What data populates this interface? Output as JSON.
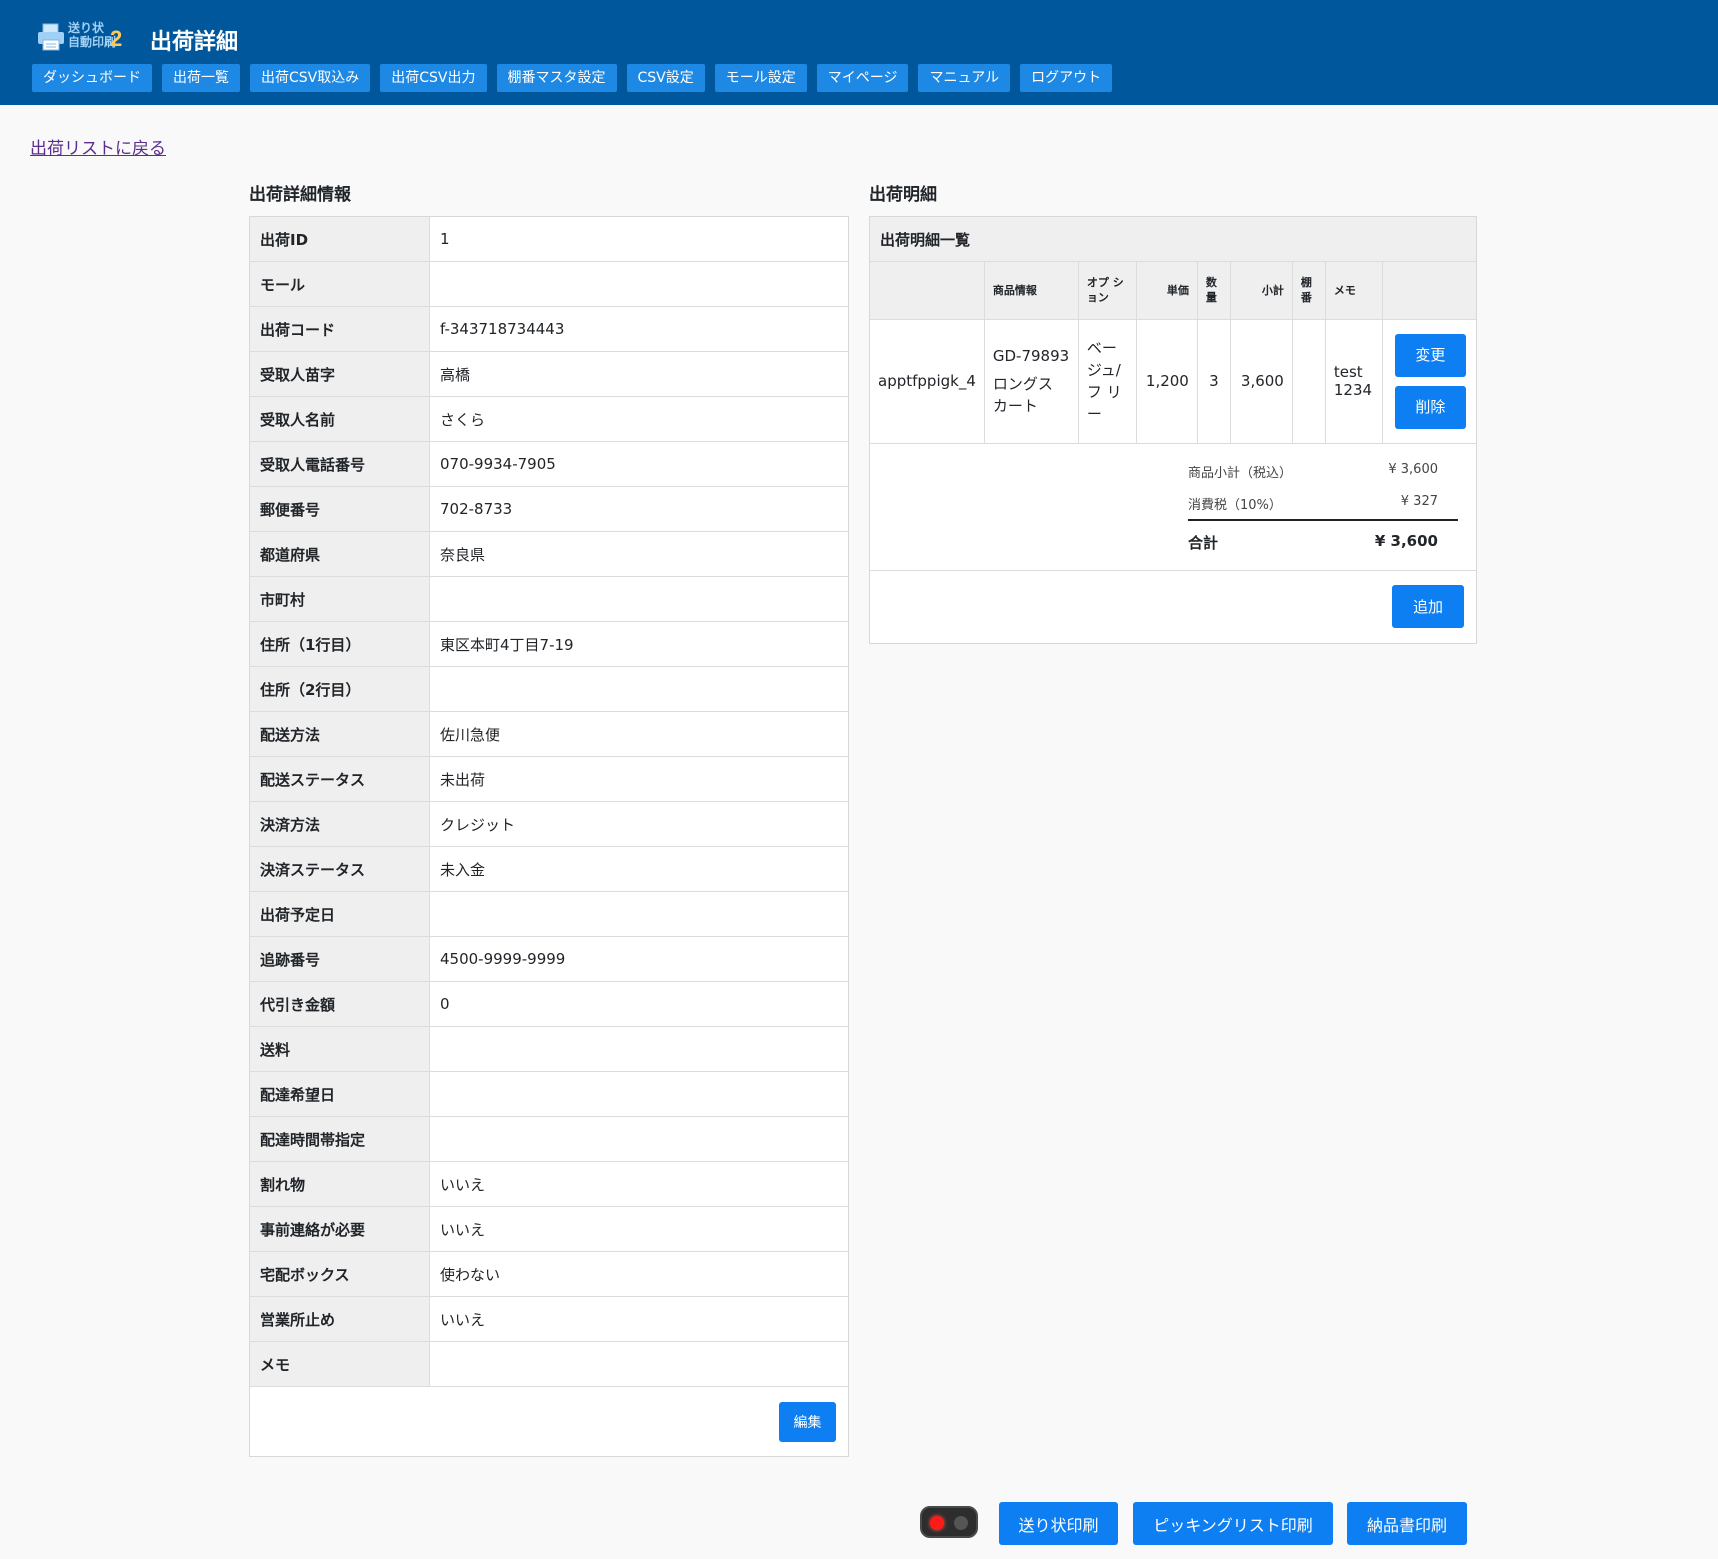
{
  "header": {
    "logo_text_line1": "送り状",
    "logo_text_line2": "自動印刷",
    "logo_number": "2",
    "title": "出荷詳細",
    "nav": [
      "ダッシュボード",
      "出荷一覧",
      "出荷CSV取込み",
      "出荷CSV出力",
      "棚番マスタ設定",
      "CSV設定",
      "モール設定",
      "マイページ",
      "マニュアル",
      "ログアウト"
    ]
  },
  "back_link": "出荷リストに戻る",
  "detail": {
    "title": "出荷詳細情報",
    "rows": [
      {
        "label": "出荷ID",
        "value": "1"
      },
      {
        "label": "モール",
        "value": ""
      },
      {
        "label": "出荷コード",
        "value": "f-343718734443"
      },
      {
        "label": "受取人苗字",
        "value": "高橋"
      },
      {
        "label": "受取人名前",
        "value": "さくら"
      },
      {
        "label": "受取人電話番号",
        "value": "070-9934-7905"
      },
      {
        "label": "郵便番号",
        "value": "702-8733"
      },
      {
        "label": "都道府県",
        "value": "奈良県"
      },
      {
        "label": "市町村",
        "value": ""
      },
      {
        "label": "住所（1行目）",
        "value": "東区本町4丁目7-19"
      },
      {
        "label": "住所（2行目）",
        "value": ""
      },
      {
        "label": "配送方法",
        "value": "佐川急便"
      },
      {
        "label": "配送ステータス",
        "value": "未出荷"
      },
      {
        "label": "決済方法",
        "value": "クレジット"
      },
      {
        "label": "決済ステータス",
        "value": "未入金"
      },
      {
        "label": "出荷予定日",
        "value": ""
      },
      {
        "label": "追跡番号",
        "value": "4500-9999-9999"
      },
      {
        "label": "代引き金額",
        "value": "0"
      },
      {
        "label": "送料",
        "value": ""
      },
      {
        "label": "配達希望日",
        "value": ""
      },
      {
        "label": "配達時間帯指定",
        "value": ""
      },
      {
        "label": "割れ物",
        "value": "いいえ"
      },
      {
        "label": "事前連絡が必要",
        "value": "いいえ"
      },
      {
        "label": "宅配ボックス",
        "value": "使わない"
      },
      {
        "label": "営業所止め",
        "value": "いいえ"
      },
      {
        "label": "メモ",
        "value": ""
      }
    ],
    "edit_label": "編集"
  },
  "items": {
    "title": "出荷明細",
    "list_title": "出荷明細一覧",
    "columns": [
      "",
      "商品情報",
      "オプ ション",
      "単価",
      "数 量",
      "小計",
      "棚 番",
      "メモ",
      ""
    ],
    "rows": [
      {
        "sku_id": "apptfppigk_4",
        "product_code": "GD-79893",
        "product_name": "ロングス カート",
        "option": "ベー ジュ/ フ リー",
        "price": "1,200",
        "qty": "3",
        "subtotal": "3,600",
        "shelf": "",
        "memo": "test 1234",
        "change_label": "変更",
        "delete_label": "削除"
      }
    ],
    "subtotal_label": "商品小計（税込）",
    "subtotal_value": "¥ 3,600",
    "tax_label": "消費税（10%）",
    "tax_value": "¥ 327",
    "total_label": "合計",
    "total_value": "¥ 3,600",
    "add_label": "追加"
  },
  "footer": {
    "print_label_slip": "送り状印刷",
    "print_picking": "ピッキングリスト印刷",
    "print_delivery": "納品書印刷",
    "colors": {
      "led_on": "#ff1a1a",
      "led_off": "#555555",
      "button": "#0d7ff2"
    }
  }
}
